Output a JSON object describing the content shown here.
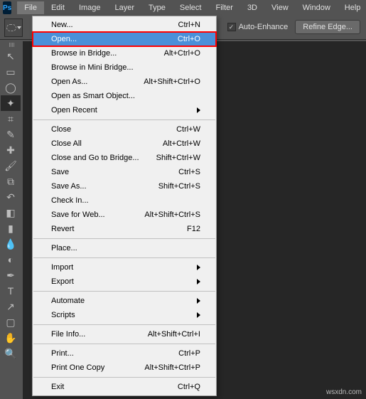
{
  "menubar": {
    "items": [
      "File",
      "Edit",
      "Image",
      "Layer",
      "Type",
      "Select",
      "Filter",
      "3D",
      "View",
      "Window",
      "Help"
    ],
    "active_index": 0
  },
  "options_bar": {
    "auto_enhance_label": "Auto-Enhance",
    "auto_enhance_checked": true,
    "refine_edge_label": "Refine Edge..."
  },
  "toolbox": {
    "tools": [
      {
        "name": "move-tool",
        "glyph": "↖"
      },
      {
        "name": "rect-marquee-tool",
        "glyph": "▭"
      },
      {
        "name": "lasso-tool",
        "glyph": "◯"
      },
      {
        "name": "quick-select-tool",
        "glyph": "✦",
        "active": true
      },
      {
        "name": "crop-tool",
        "glyph": "⌗"
      },
      {
        "name": "eyedropper-tool",
        "glyph": "✎"
      },
      {
        "name": "healing-brush-tool",
        "glyph": "✚"
      },
      {
        "name": "brush-tool",
        "glyph": "🖌"
      },
      {
        "name": "clone-stamp-tool",
        "glyph": "⧉"
      },
      {
        "name": "history-brush-tool",
        "glyph": "↶"
      },
      {
        "name": "eraser-tool",
        "glyph": "◧"
      },
      {
        "name": "gradient-tool",
        "glyph": "▮"
      },
      {
        "name": "blur-tool",
        "glyph": "💧"
      },
      {
        "name": "dodge-tool",
        "glyph": "◐"
      },
      {
        "name": "pen-tool",
        "glyph": "✒"
      },
      {
        "name": "type-tool",
        "glyph": "T"
      },
      {
        "name": "path-select-tool",
        "glyph": "↗"
      },
      {
        "name": "rectangle-tool",
        "glyph": "▢"
      },
      {
        "name": "hand-tool",
        "glyph": "✋"
      },
      {
        "name": "zoom-tool",
        "glyph": "🔍"
      }
    ]
  },
  "file_menu": {
    "groups": [
      [
        {
          "label": "New...",
          "shortcut": "Ctrl+N"
        },
        {
          "label": "Open...",
          "shortcut": "Ctrl+O",
          "highlighted": true
        },
        {
          "label": "Browse in Bridge...",
          "shortcut": "Alt+Ctrl+O"
        },
        {
          "label": "Browse in Mini Bridge..."
        },
        {
          "label": "Open As...",
          "shortcut": "Alt+Shift+Ctrl+O"
        },
        {
          "label": "Open as Smart Object..."
        },
        {
          "label": "Open Recent",
          "submenu": true
        }
      ],
      [
        {
          "label": "Close",
          "shortcut": "Ctrl+W"
        },
        {
          "label": "Close All",
          "shortcut": "Alt+Ctrl+W"
        },
        {
          "label": "Close and Go to Bridge...",
          "shortcut": "Shift+Ctrl+W"
        },
        {
          "label": "Save",
          "shortcut": "Ctrl+S"
        },
        {
          "label": "Save As...",
          "shortcut": "Shift+Ctrl+S"
        },
        {
          "label": "Check In..."
        },
        {
          "label": "Save for Web...",
          "shortcut": "Alt+Shift+Ctrl+S"
        },
        {
          "label": "Revert",
          "shortcut": "F12"
        }
      ],
      [
        {
          "label": "Place..."
        }
      ],
      [
        {
          "label": "Import",
          "submenu": true
        },
        {
          "label": "Export",
          "submenu": true
        }
      ],
      [
        {
          "label": "Automate",
          "submenu": true
        },
        {
          "label": "Scripts",
          "submenu": true
        }
      ],
      [
        {
          "label": "File Info...",
          "shortcut": "Alt+Shift+Ctrl+I"
        }
      ],
      [
        {
          "label": "Print...",
          "shortcut": "Ctrl+P"
        },
        {
          "label": "Print One Copy",
          "shortcut": "Alt+Shift+Ctrl+P"
        }
      ],
      [
        {
          "label": "Exit",
          "shortcut": "Ctrl+Q"
        }
      ]
    ]
  },
  "watermark": "wsxdn.com"
}
